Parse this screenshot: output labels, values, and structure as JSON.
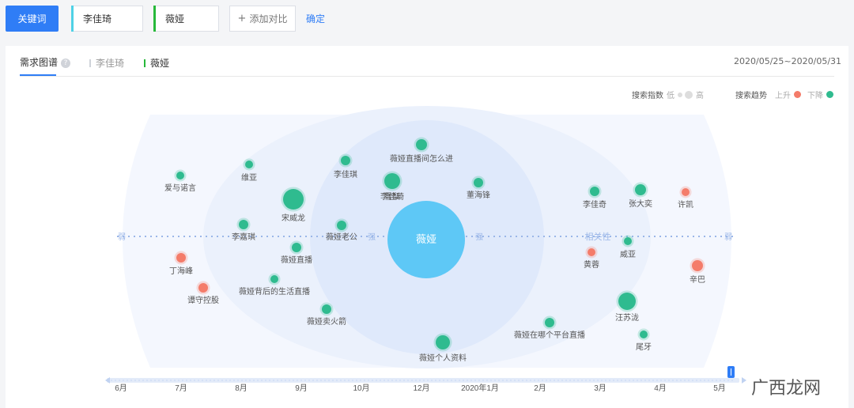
{
  "toolbar": {
    "keyword_label": "关键词",
    "compare1": "李佳琦",
    "compare2": "薇娅",
    "add_label": "添加对比",
    "confirm_label": "确定"
  },
  "tabs": {
    "main": "需求图谱",
    "help": "?",
    "series1": "李佳琦",
    "series2": "薇娅",
    "date_range": "2020/05/25~2020/05/31"
  },
  "legend": {
    "index_label": "搜索指数",
    "low": "低",
    "high": "高",
    "trend_label": "搜索趋势",
    "up": "上升",
    "down": "下降"
  },
  "colors": {
    "accent": "#2f7df6",
    "series1": "#4fd1e6",
    "series2": "#27b83a",
    "up": "#f47c6a",
    "down": "#2fbb8f",
    "center": "#5ec8f6"
  },
  "graph": {
    "axis_label_strong": "强",
    "axis_label_weak": "弱",
    "relevance_label": "相关性",
    "center_label": "薇娅",
    "nodes": [
      {
        "label": "薇娅直播间怎么进",
        "trend": "down"
      },
      {
        "label": "李佳琪",
        "trend": "down"
      },
      {
        "label": "雪梨",
        "trend": "down"
      },
      {
        "label": "爱与诺言",
        "trend": "down"
      },
      {
        "label": "维亚",
        "trend": "down"
      },
      {
        "label": "李佳琦",
        "trend": "down"
      },
      {
        "label": "董海锋",
        "trend": "down"
      },
      {
        "label": "宋威龙",
        "trend": "down"
      },
      {
        "label": "李佳奇",
        "trend": "down"
      },
      {
        "label": "张大奕",
        "trend": "down"
      },
      {
        "label": "许凯",
        "trend": "up"
      },
      {
        "label": "李嘉琪",
        "trend": "down"
      },
      {
        "label": "薇娅老公",
        "trend": "down"
      },
      {
        "label": "薇娅直播",
        "trend": "down"
      },
      {
        "label": "丁海峰",
        "trend": "up"
      },
      {
        "label": "黄蓉",
        "trend": "up"
      },
      {
        "label": "威亚",
        "trend": "down"
      },
      {
        "label": "辛巴",
        "trend": "up"
      },
      {
        "label": "谭守控股",
        "trend": "up"
      },
      {
        "label": "薇娅背后的生活直播",
        "trend": "down"
      },
      {
        "label": "薇娅卖火箭",
        "trend": "down"
      },
      {
        "label": "汪苏泷",
        "trend": "down"
      },
      {
        "label": "薇娅在哪个平台直播",
        "trend": "down"
      },
      {
        "label": "尾牙",
        "trend": "down"
      },
      {
        "label": "薇娅个人资料",
        "trend": "down"
      }
    ]
  },
  "timeline": {
    "ticks": [
      "6月",
      "7月",
      "8月",
      "9月",
      "10月",
      "12月",
      "2020年1月",
      "2月",
      "3月",
      "4月",
      "5月"
    ]
  },
  "watermark": "广西龙网"
}
